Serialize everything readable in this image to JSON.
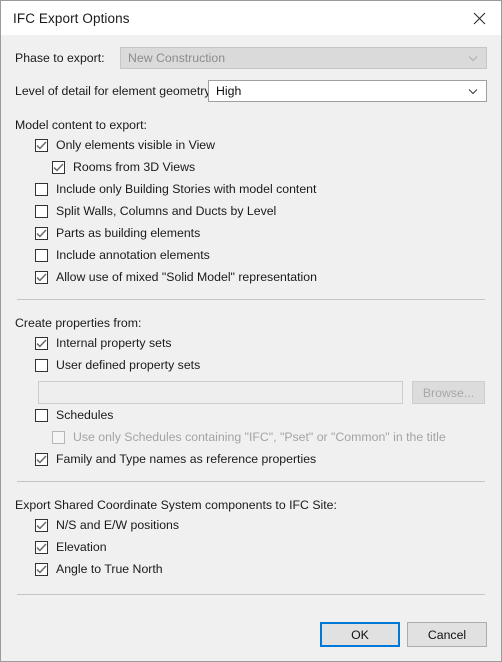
{
  "window": {
    "title": "IFC Export Options",
    "close_icon": "close-icon"
  },
  "fields": {
    "phase": {
      "label": "Phase to export:",
      "value": "New Construction",
      "disabled": true,
      "arrow_icon": "chevron-down-icon"
    },
    "level_of_detail": {
      "label": "Level of detail for element geometry:",
      "value": "High",
      "disabled": false,
      "arrow_icon": "chevron-down-icon"
    }
  },
  "sections": {
    "model_content": {
      "label": "Model content to export:",
      "items": [
        {
          "label": "Only elements visible in View",
          "checked": true,
          "indent": 0,
          "disabled": false
        },
        {
          "label": "Rooms from 3D Views",
          "checked": true,
          "indent": 1,
          "disabled": false
        },
        {
          "label": "Include only Building Stories with model content",
          "checked": false,
          "indent": 0,
          "disabled": false
        },
        {
          "label": "Split Walls, Columns and Ducts by Level",
          "checked": false,
          "indent": 0,
          "disabled": false
        },
        {
          "label": "Parts as building elements",
          "checked": true,
          "indent": 0,
          "disabled": false
        },
        {
          "label": "Include annotation elements",
          "checked": false,
          "indent": 0,
          "disabled": false
        },
        {
          "label": "Allow use of mixed \"Solid Model\" representation",
          "checked": true,
          "indent": 0,
          "disabled": false
        }
      ]
    },
    "create_properties": {
      "label": "Create properties from:",
      "items": [
        {
          "label": "Internal property sets",
          "checked": true,
          "indent": 0,
          "disabled": false
        },
        {
          "label": "User defined property sets",
          "checked": false,
          "indent": 0,
          "disabled": false
        }
      ],
      "path_field": {
        "value": "",
        "placeholder": "",
        "disabled": true
      },
      "browse_button": {
        "label": "Browse...",
        "disabled": true
      },
      "items_after": [
        {
          "label": "Schedules",
          "checked": false,
          "indent": 0,
          "disabled": false
        },
        {
          "label": "Use only Schedules containing \"IFC\", \"Pset\" or \"Common\" in the title",
          "checked": false,
          "indent": 1,
          "disabled": true
        },
        {
          "label": "Family and Type names as reference properties",
          "checked": true,
          "indent": 0,
          "disabled": false
        }
      ]
    },
    "shared_coordinates": {
      "label": "Export Shared Coordinate System components to IFC Site:",
      "items": [
        {
          "label": "N/S and E/W positions",
          "checked": true,
          "indent": 0,
          "disabled": false
        },
        {
          "label": "Elevation",
          "checked": true,
          "indent": 0,
          "disabled": false
        },
        {
          "label": "Angle to True North",
          "checked": true,
          "indent": 0,
          "disabled": false
        }
      ]
    }
  },
  "footer": {
    "ok_label": "OK",
    "cancel_label": "Cancel"
  },
  "colors": {
    "accent": "#0078d7",
    "dialog_background": "#f0f0f0",
    "titlebar_background": "#ffffff",
    "checkmark": "#6b6b6b",
    "disabled_text": "#a3a3a3"
  }
}
